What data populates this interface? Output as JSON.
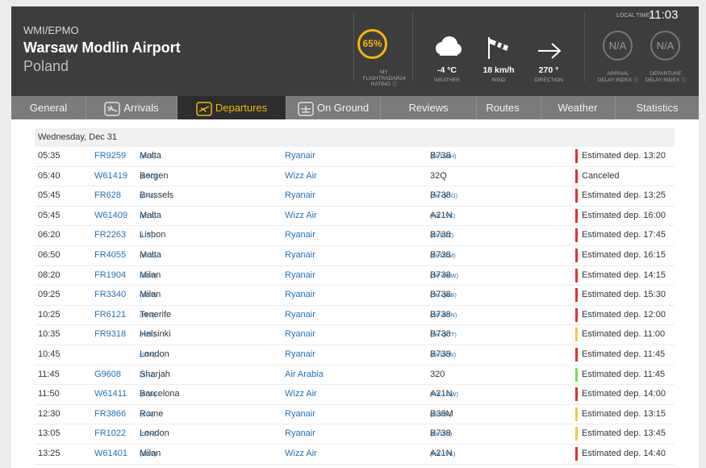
{
  "airport": {
    "codes": "WMI/EPMO",
    "name": "Warsaw Modlin Airport",
    "country": "Poland"
  },
  "rating": {
    "value": "65%",
    "label_lines": [
      "MY",
      "FLIGHTRADAR24",
      "RATING"
    ]
  },
  "weather": {
    "temperature": "-4 °C",
    "temperature_label": "WEATHER",
    "wind": "18 km/h",
    "wind_label": "WIND",
    "direction": "270 °",
    "direction_label": "DIRECTION"
  },
  "delays": {
    "arrival_value": "N/A",
    "arrival_label_lines": [
      "ARRIVAL",
      "DELAY INDEX"
    ],
    "departure_value": "N/A",
    "departure_label_lines": [
      "DEPARTURE",
      "DELAY INDEX"
    ]
  },
  "local_time": {
    "label": "LOCAL TIME:",
    "value": "11:03"
  },
  "tabs": [
    {
      "label": "General",
      "icon": ""
    },
    {
      "label": "Arrivals",
      "icon": "arrival-plane-icon"
    },
    {
      "label": "Departures",
      "icon": "departure-plane-icon"
    },
    {
      "label": "On Ground",
      "icon": "on-ground-plane-icon"
    },
    {
      "label": "Reviews",
      "icon": ""
    },
    {
      "label": "Routes",
      "icon": ""
    },
    {
      "label": "Weather",
      "icon": ""
    },
    {
      "label": "Statistics",
      "icon": ""
    }
  ],
  "active_tab": "Departures",
  "colors": {
    "accent": "#f2b705",
    "link": "#2473b4",
    "status_red": "#e03131",
    "status_yellow": "#f2c94c",
    "status_green": "#7ed957"
  },
  "date_label": "Wednesday, Dec 31",
  "flights": [
    {
      "time": "05:35",
      "flight": "FR9259",
      "dest": "Malta",
      "dest_code": "(MLA)",
      "airline": "Ryanair",
      "aircraft": "B738",
      "reg": "(EI-DWH)",
      "status": "Estimated dep. 13:20",
      "status_color": "red"
    },
    {
      "time": "05:40",
      "flight": "W61419",
      "dest": "Bergen",
      "dest_code": "(BGO)",
      "airline": "Wizz Air",
      "aircraft": "32Q",
      "reg": "",
      "status": "Canceled",
      "status_color": "red"
    },
    {
      "time": "05:45",
      "flight": "FR628",
      "dest": "Brussels",
      "dest_code": "(CRL)",
      "airline": "Ryanair",
      "aircraft": "B738",
      "reg": "(9H-QCG)",
      "status": "Estimated dep. 13:25",
      "status_color": "red"
    },
    {
      "time": "05:45",
      "flight": "W61409",
      "dest": "Malta",
      "dest_code": "(MLA)",
      "airline": "Wizz Air",
      "aircraft": "A21N",
      "reg": "(HA-LVK)",
      "status": "Estimated dep. 16:00",
      "status_color": "red"
    },
    {
      "time": "06:20",
      "flight": "FR2263",
      "dest": "Lisbon",
      "dest_code": "(LIS)",
      "airline": "Ryanair",
      "aircraft": "B738",
      "reg": "(EI-EBZ)",
      "status": "Estimated dep. 17:45",
      "status_color": "red"
    },
    {
      "time": "06:50",
      "flight": "FR4055",
      "dest": "Malta",
      "dest_code": "(MLA)",
      "airline": "Ryanair",
      "aircraft": "B738",
      "reg": "(EI-DCM)",
      "status": "Estimated dep. 16:15",
      "status_color": "red"
    },
    {
      "time": "08:20",
      "flight": "FR1904",
      "dest": "Milan",
      "dest_code": "(BGY)",
      "airline": "Ryanair",
      "aircraft": "B738",
      "reg": "(SP-RKW)",
      "status": "Estimated dep. 14:15",
      "status_color": "red"
    },
    {
      "time": "09:25",
      "flight": "FR3340",
      "dest": "Milan",
      "dest_code": "(BGY)",
      "airline": "Ryanair",
      "aircraft": "B738",
      "reg": "(9H-QAB)",
      "status": "Estimated dep. 15:30",
      "status_color": "red"
    },
    {
      "time": "10:25",
      "flight": "FR6121",
      "dest": "Tenerife",
      "dest_code": "(TFS)",
      "airline": "Ryanair",
      "aircraft": "B738",
      "reg": "(SP-RSN)",
      "status": "Estimated dep. 12:00",
      "status_color": "red"
    },
    {
      "time": "10:35",
      "flight": "FR9318",
      "dest": "Helsinki",
      "dest_code": "(HEL)",
      "airline": "Ryanair",
      "aircraft": "B738",
      "reg": "(9H-QCT)",
      "status": "Estimated dep. 11:00",
      "status_color": "yellow"
    },
    {
      "time": "10:45",
      "flight": "",
      "dest": "London",
      "dest_code": "(STN)",
      "airline": "Ryanair",
      "aircraft": "B738",
      "reg": "(EI-DYW)",
      "status": "Estimated dep. 11:45",
      "status_color": "red"
    },
    {
      "time": "11:45",
      "flight": "G9608",
      "dest": "Sharjah",
      "dest_code": "(SHJ)",
      "airline": "Air Arabia",
      "aircraft": "320",
      "reg": "",
      "status": "Estimated dep. 11:45",
      "status_color": "green"
    },
    {
      "time": "11:50",
      "flight": "W61411",
      "dest": "Barcelona",
      "dest_code": "(BCN)",
      "airline": "Wizz Air",
      "aircraft": "A21N",
      "reg": "(HA-LGW)",
      "status": "Estimated dep. 14:00",
      "status_color": "red"
    },
    {
      "time": "12:30",
      "flight": "FR3866",
      "dest": "Rome",
      "dest_code": "(CIA)",
      "airline": "Ryanair",
      "aircraft": "B38M",
      "reg": "(EI-IJM)",
      "status": "Estimated dep. 13:15",
      "status_color": "yellow"
    },
    {
      "time": "13:05",
      "flight": "FR1022",
      "dest": "London",
      "dest_code": "(STN)",
      "airline": "Ryanair",
      "aircraft": "B738",
      "reg": "(EI-DPI)",
      "status": "Estimated dep. 13:45",
      "status_color": "yellow"
    },
    {
      "time": "13:25",
      "flight": "W61401",
      "dest": "Milan",
      "dest_code": "(BGY)",
      "airline": "Wizz Air",
      "aircraft": "A21N",
      "reg": "(HA-LVK)",
      "status": "Estimated dep. 14:40",
      "status_color": "red"
    }
  ]
}
